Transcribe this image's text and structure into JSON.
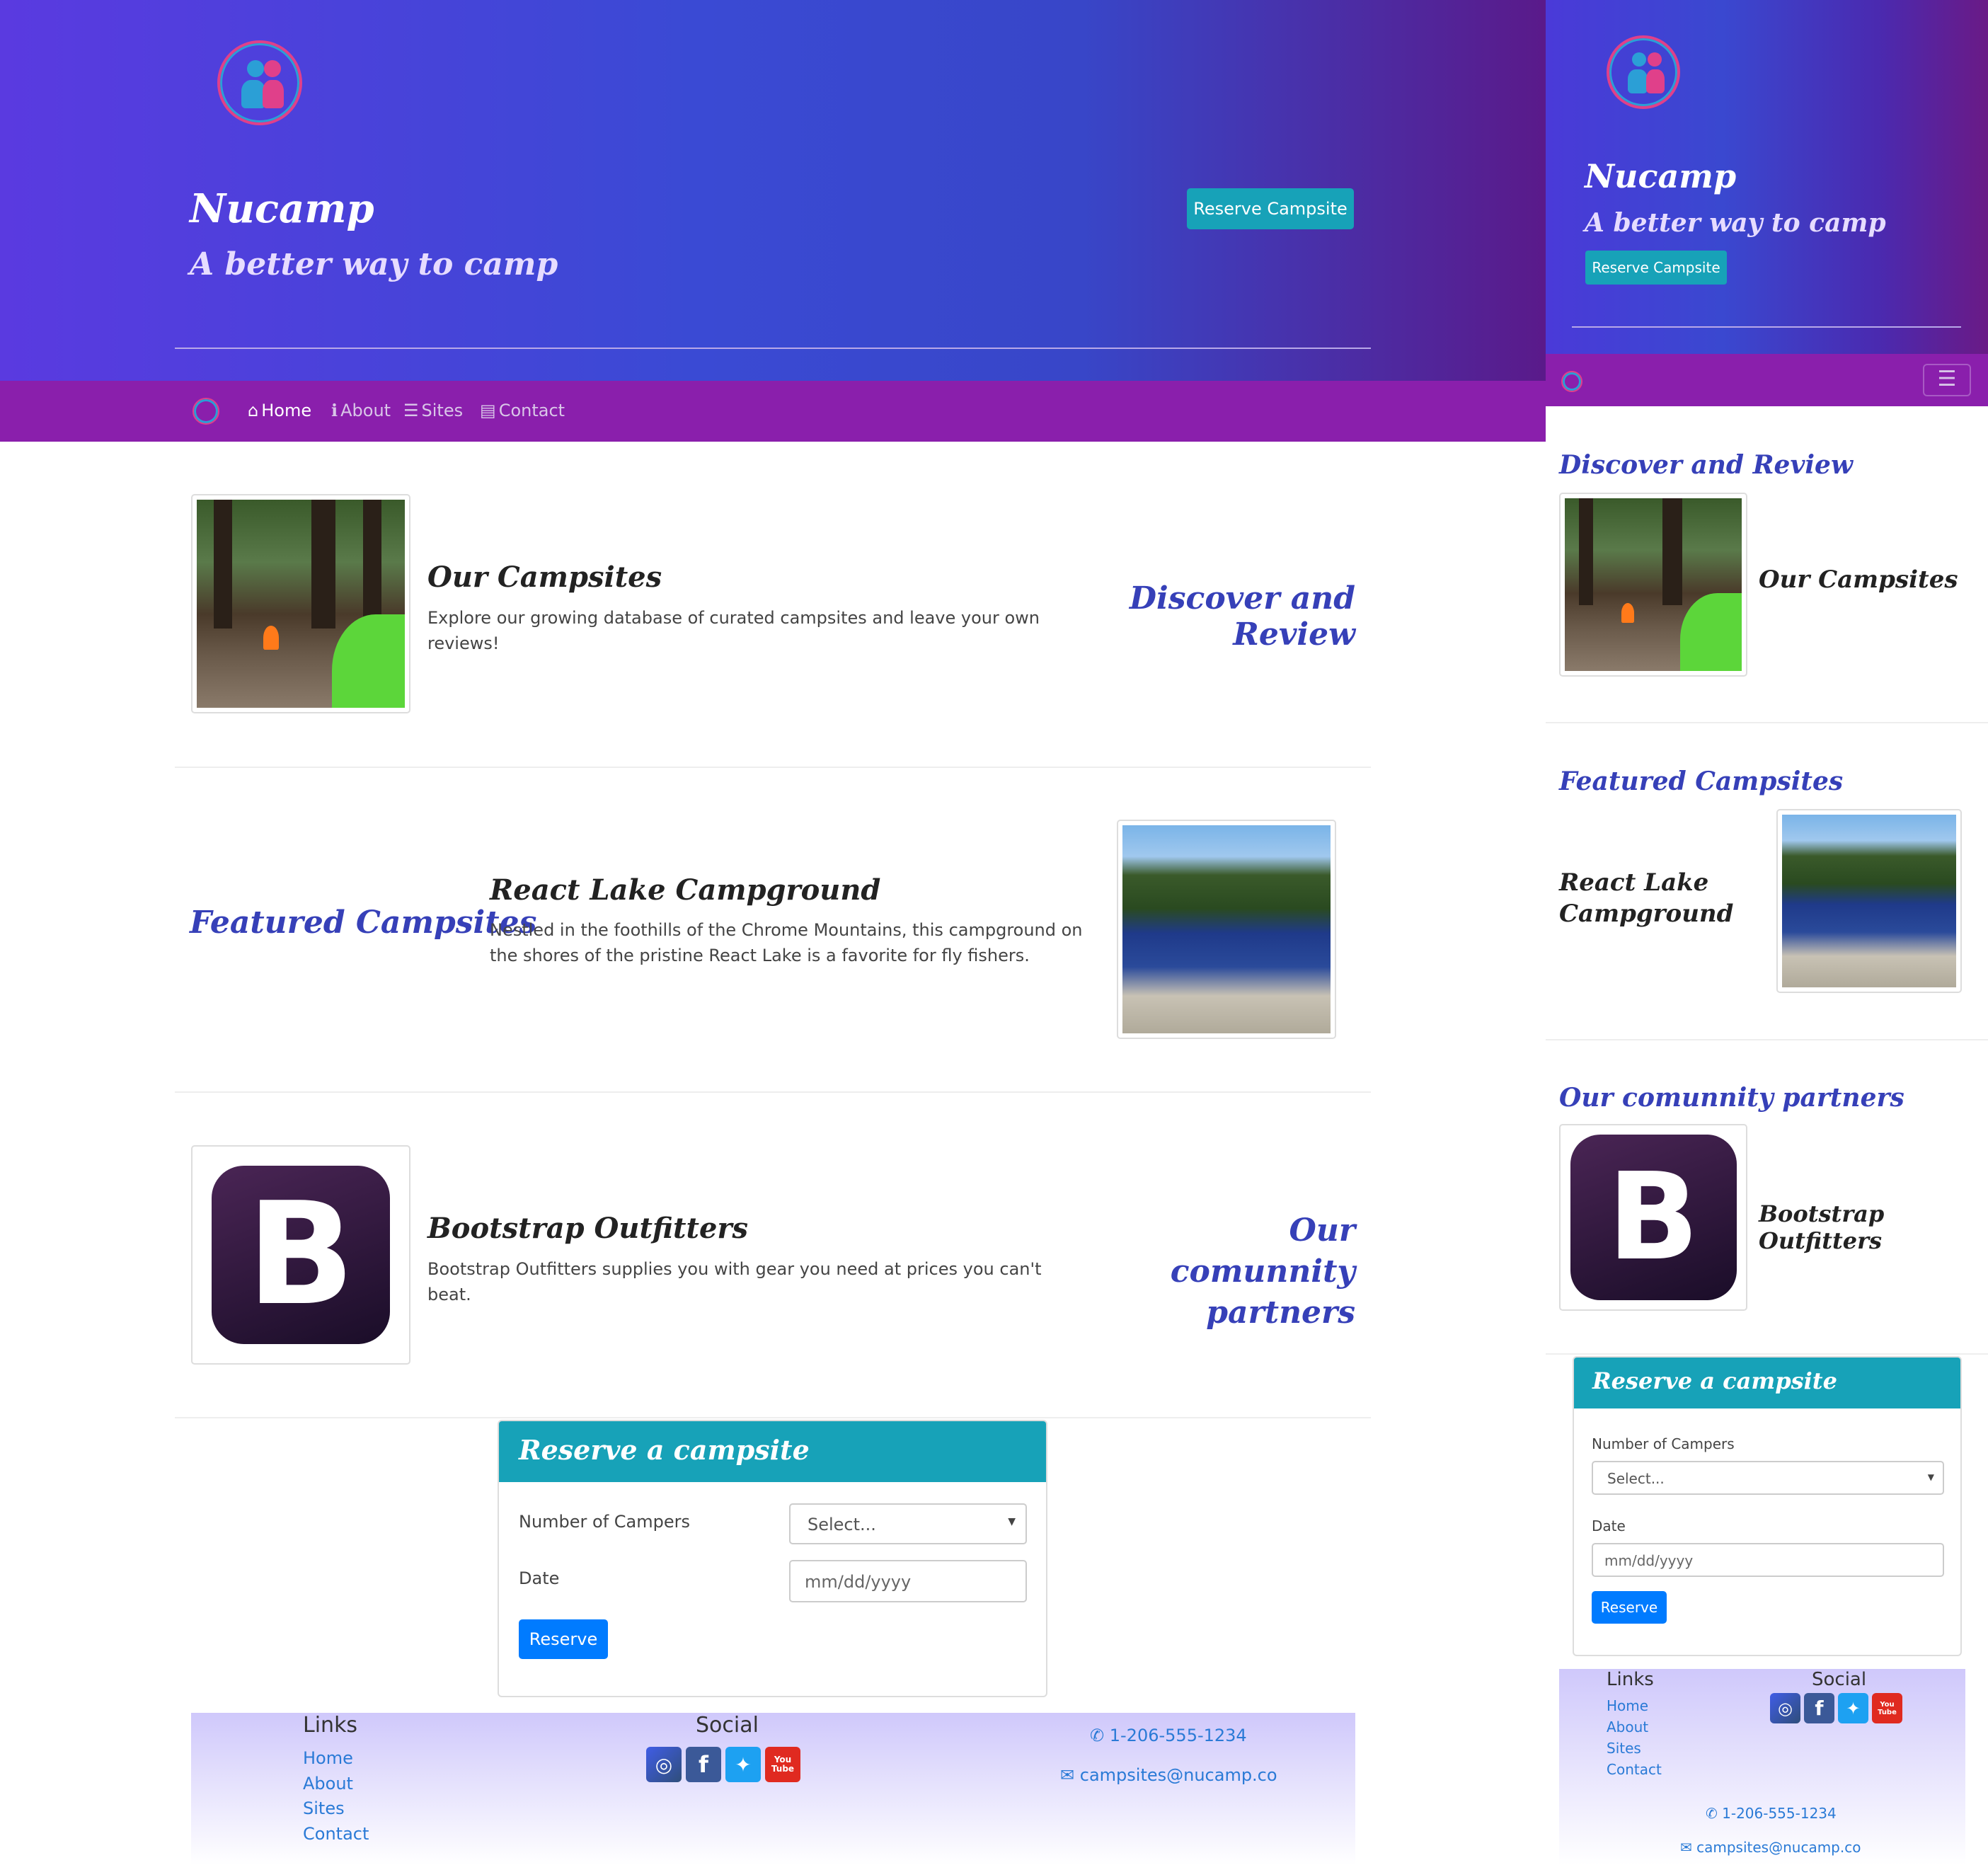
{
  "brand": {
    "title": "Nucamp",
    "tagline": "A better way to camp",
    "reserve_button": "Reserve Campsite"
  },
  "nav": {
    "items": [
      {
        "label": "Home",
        "icon": "home-icon",
        "active": true
      },
      {
        "label": "About",
        "icon": "info-icon",
        "active": false
      },
      {
        "label": "Sites",
        "icon": "list-icon",
        "active": false
      },
      {
        "label": "Contact",
        "icon": "address-card-icon",
        "active": false
      }
    ]
  },
  "sections": {
    "campsites": {
      "heading": "Discover and Review",
      "title": "Our Campsites",
      "text": "Explore our growing database of curated campsites and leave your own reviews!"
    },
    "featured": {
      "heading": "Featured Campsites",
      "title": "React Lake Campground",
      "text": "Nestled in the foothills of the Chrome Mountains, this campground on the shores of the pristine React Lake is a favorite for fly fishers."
    },
    "partners": {
      "heading": "Our comunnity partners",
      "title": "Bootstrap Outfitters",
      "text": "Bootstrap Outfitters supplies you with gear you need at prices you can't beat.",
      "logo_letter": "B"
    }
  },
  "reserve_form": {
    "heading": "Reserve a campsite",
    "campers_label": "Number of Campers",
    "campers_value": "Select...",
    "date_label": "Date",
    "date_placeholder": "mm/dd/yyyy",
    "submit": "Reserve"
  },
  "footer": {
    "links_heading": "Links",
    "links": [
      "Home",
      "About",
      "Sites",
      "Contact"
    ],
    "social_heading": "Social",
    "social": [
      "instagram-icon",
      "facebook-icon",
      "twitter-icon",
      "youtube-icon"
    ],
    "youtube_label": "You Tube",
    "phone": "1-206-555-1234",
    "email": "campsites@nucamp.co"
  },
  "colors": {
    "accent_teal": "#17a2b8",
    "nav_purple": "#8a1fac",
    "heading_blue": "#3640b8",
    "button_blue": "#007bff"
  }
}
